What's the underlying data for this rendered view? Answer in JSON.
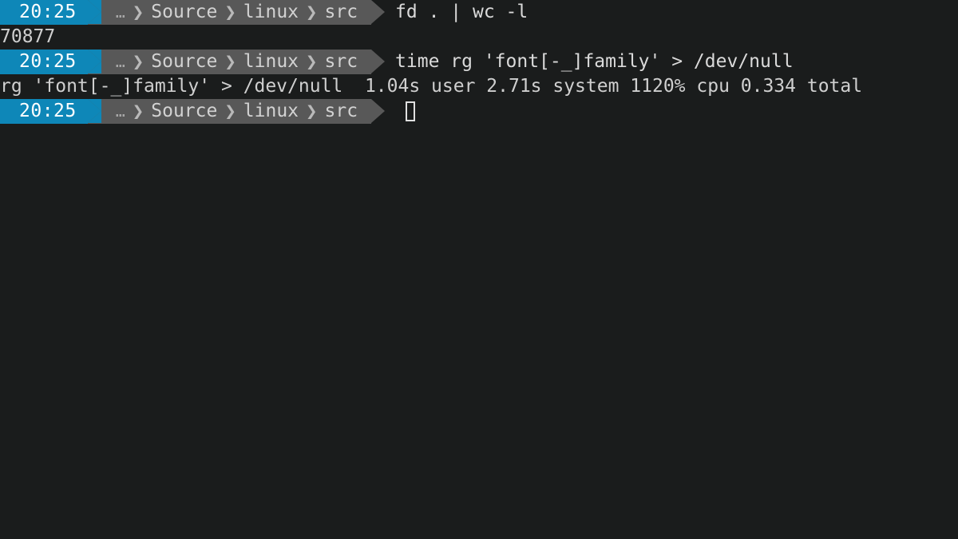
{
  "terminal": {
    "background_color": "#1a1c1c",
    "foreground_color": "#cfcfcf",
    "accent_color": "#0e87b8",
    "segment_color": "#585858",
    "cursor_color": "#e0e0e0"
  },
  "prompt": {
    "time": "20:25",
    "ellipsis": "…",
    "separator": "❯",
    "path": [
      "Source",
      "linux",
      "src"
    ]
  },
  "lines": [
    {
      "kind": "prompt",
      "command": "fd . | wc -l"
    },
    {
      "kind": "output",
      "text": "70877"
    },
    {
      "kind": "prompt",
      "command": "time rg 'font[-_]family' > /dev/null"
    },
    {
      "kind": "output",
      "text": "rg 'font[-_]family' > /dev/null  1.04s user 2.71s system 1120% cpu 0.334 total"
    },
    {
      "kind": "prompt",
      "command": ""
    }
  ]
}
